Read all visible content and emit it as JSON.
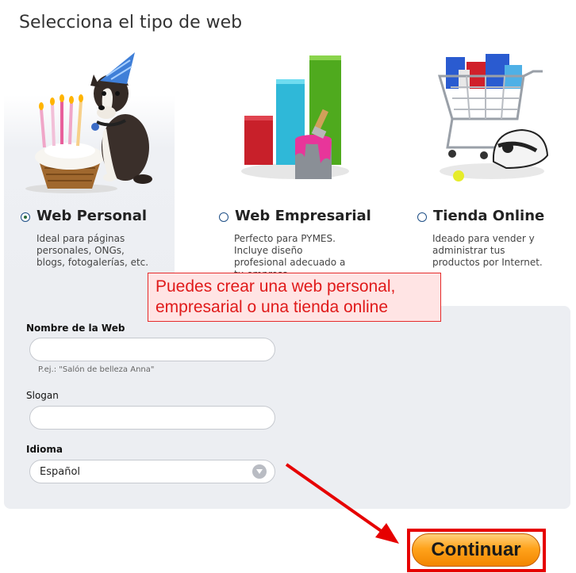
{
  "page": {
    "title": "Selecciona el tipo de web"
  },
  "options": [
    {
      "title": "Web Personal",
      "description": "Ideal para páginas personales, ONGs, blogs, fotogalerías, etc.",
      "selected": true
    },
    {
      "title": "Web Empresarial",
      "description": "Perfecto para PYMES. Incluye diseño profesional adecuado a tu empresa.",
      "selected": false
    },
    {
      "title": "Tienda Online",
      "description": "Ideado para vender y administrar tus productos por Internet.",
      "selected": false
    }
  ],
  "callout": {
    "line1": "Puedes crear una web personal,",
    "line2": "empresarial o una tienda online"
  },
  "form": {
    "name_label": "Nombre de la Web",
    "name_value": "",
    "name_hint": "P.ej.: \"Salón de belleza Anna\"",
    "slogan_label": "Slogan",
    "slogan_value": "",
    "language_label": "Idioma",
    "language_value": "Español"
  },
  "continue_label": "Continuar",
  "colors": {
    "accent_orange": "#ffa31c",
    "highlight_red": "#e60000",
    "radio_blue": "#1e4f86",
    "panel_bg": "#eceef2"
  }
}
